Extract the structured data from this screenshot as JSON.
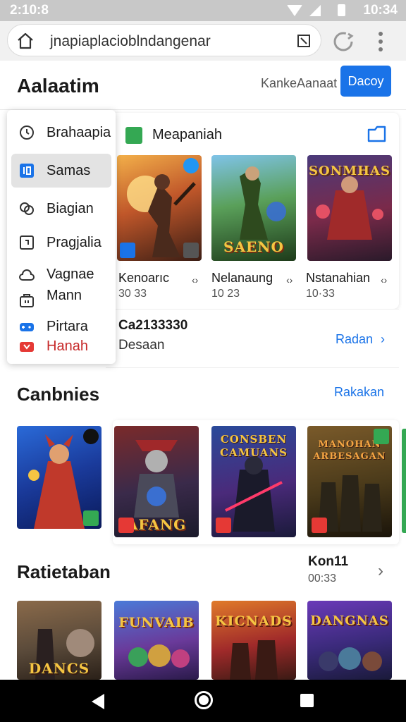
{
  "status_bar": {
    "time_left": "2:10:8",
    "time_right": "10:34"
  },
  "browser": {
    "url": "jnapiaplacioblndangenar"
  },
  "header": {
    "title": "Aalaatim",
    "link_label": "KankeAanaat",
    "button_label": "Dacoy"
  },
  "dropdown": {
    "items": [
      {
        "label": "Brahaapia",
        "icon": "clock-icon"
      },
      {
        "label": "Samas",
        "icon": "blue-app-icon"
      },
      {
        "label": "Biagian",
        "icon": "link-icon"
      },
      {
        "label": "Pragjalia",
        "icon": "square-icon"
      },
      {
        "label": "Vagnae",
        "icon": "cloud-icon"
      },
      {
        "label": "Mann",
        "icon": "bag-icon"
      },
      {
        "label": "Pirtara",
        "icon": "gamepad-icon"
      },
      {
        "label": "Hanah",
        "icon": "video-icon"
      }
    ]
  },
  "featured": {
    "title": "Meapaniah",
    "tiles": [
      {
        "name": "Kenoarıc",
        "sub": "30 33",
        "art_text": ""
      },
      {
        "name": "Nelanaung",
        "sub": "10 23",
        "art_text": "SAENO"
      },
      {
        "name": "Nstanahian",
        "sub": "10·33",
        "art_text": "SONMHAS"
      }
    ]
  },
  "info_row": {
    "title": "Ca2133330",
    "subtitle": "Desaan",
    "link_label": "Radan",
    "chevron": "›"
  },
  "section_canbnies": {
    "title": "Canbnies",
    "link_label": "Rakakan",
    "tiles": [
      {
        "art_text": ""
      },
      {
        "art_text": "AFANG"
      },
      {
        "art_text": "CONSBEN CAMUANS"
      },
      {
        "art_text": "MANOHAN ARBESAGAN"
      }
    ]
  },
  "section_rated": {
    "title": "Ratietaban",
    "meta_title": "Kon11",
    "meta_sub": "00:33",
    "chevron": "›",
    "tiles": [
      {
        "art_text": "DANCS"
      },
      {
        "art_text": "FUNVAIB"
      },
      {
        "art_text": "KICNADS"
      },
      {
        "art_text": "DANGNAS"
      }
    ]
  },
  "colors": {
    "accent": "#1a73e8",
    "status_bar": "#c8c8c8",
    "nav_bar": "#000000",
    "badge_green": "#34a853",
    "badge_red": "#e53935"
  }
}
